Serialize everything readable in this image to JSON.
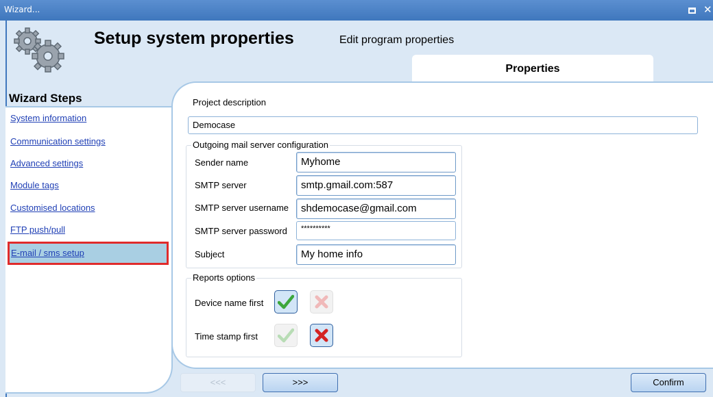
{
  "window": {
    "title": "Wizard..."
  },
  "header": {
    "title": "Setup system properties",
    "subtitle": "Edit program properties",
    "tab_label": "Properties"
  },
  "sidebar": {
    "title": "Wizard Steps",
    "items": [
      {
        "label": "System information"
      },
      {
        "label": "Communication settings"
      },
      {
        "label": "Advanced settings"
      },
      {
        "label": "Module tags"
      },
      {
        "label": "Customised locations"
      },
      {
        "label": "FTP push/pull"
      },
      {
        "label": "E-mail / sms setup",
        "active": true
      }
    ]
  },
  "form": {
    "project_description_label": "Project description",
    "project_description_value": "Democase",
    "mail_group_title": "Outgoing mail server configuration",
    "sender_name_label": "Sender name",
    "sender_name_value": "Myhome",
    "smtp_server_label": "SMTP server",
    "smtp_server_value": "smtp.gmail.com:587",
    "smtp_username_label": "SMTP server  username",
    "smtp_username_value": "shdemocase@gmail.com",
    "smtp_password_label": "SMTP server password",
    "smtp_password_value": "**********",
    "subject_label": "Subject",
    "subject_value": "My home info",
    "reports_group_title": "Reports options",
    "device_name_first_label": "Device name first",
    "device_name_first": true,
    "time_stamp_first_label": "Time stamp first",
    "time_stamp_first": false
  },
  "buttons": {
    "prev_label": "<<<",
    "next_label": ">>>",
    "confirm_label": "Confirm"
  },
  "colors": {
    "title_bar": "#4a82c6",
    "link": "#1f3fb5",
    "active_step_bg": "#a9cfe3",
    "active_step_border": "#e02b2b",
    "panel_border": "#a7c8e6"
  },
  "icons": [
    "gears-logo-icon",
    "restore-window-icon",
    "close-icon",
    "check-icon",
    "cross-icon"
  ]
}
